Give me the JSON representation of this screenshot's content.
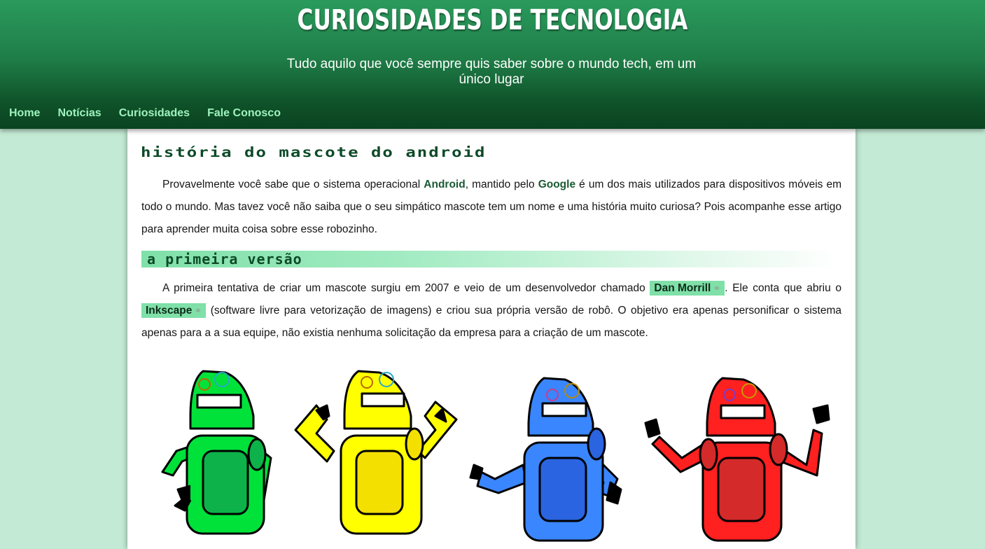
{
  "site": {
    "title": "CURIOSIDADES DE TECNOLOGIA",
    "subtitle": "Tudo aquilo que você sempre quis saber sobre o mundo tech, em um único lugar"
  },
  "nav": {
    "items": [
      "Home",
      "Notícias",
      "Curiosidades",
      "Fale Conosco"
    ]
  },
  "article": {
    "title": "História do mascote do android",
    "intro": {
      "t1": "Provavelmente você sabe que o sistema operacional ",
      "k1": "Android",
      "t2": ", mantido pelo ",
      "k2": "Google",
      "t3": " é um dos mais utilizados para dispositivos móveis em todo o mundo. Mas tavez você não saiba que o seu simpático mascote tem um nome e uma história muito curiosa? Pois acompanhe esse artigo para aprender muita coisa sobre esse robozinho."
    },
    "section1": {
      "heading": "A primeira versão",
      "t1": "A primeira tentativa de criar um mascote surgiu em 2007 e veio de um desenvolvedor chamado ",
      "link1": "Dan Morrill",
      "t2": ". Ele conta que abriu o ",
      "link2": "Inkscape",
      "t3": " (software livre para vetorização de imagens) e criou sua própria versão de robô. O objetivo era apenas personificar o sistema apenas para a a sua equipe, não existia nenhuma solicitação da empresa para a criação de um mascote."
    },
    "figure": {
      "robots": [
        {
          "name": "green",
          "body": "#00e23a",
          "dark": "#0db34a"
        },
        {
          "name": "yellow",
          "body": "#ffff00",
          "dark": "#f4e000"
        },
        {
          "name": "blue",
          "body": "#3a86ff",
          "dark": "#2a64e0"
        },
        {
          "name": "red",
          "body": "#ff2020",
          "dark": "#d42a2a"
        }
      ]
    },
    "link_icon": "link-icon"
  },
  "colors": {
    "header_top": "#2a9a5c",
    "header_bottom": "#0a4320",
    "nav_link": "#9ef2bd",
    "page_bg": "#c3ead4",
    "accent": "#7fe0a8"
  }
}
